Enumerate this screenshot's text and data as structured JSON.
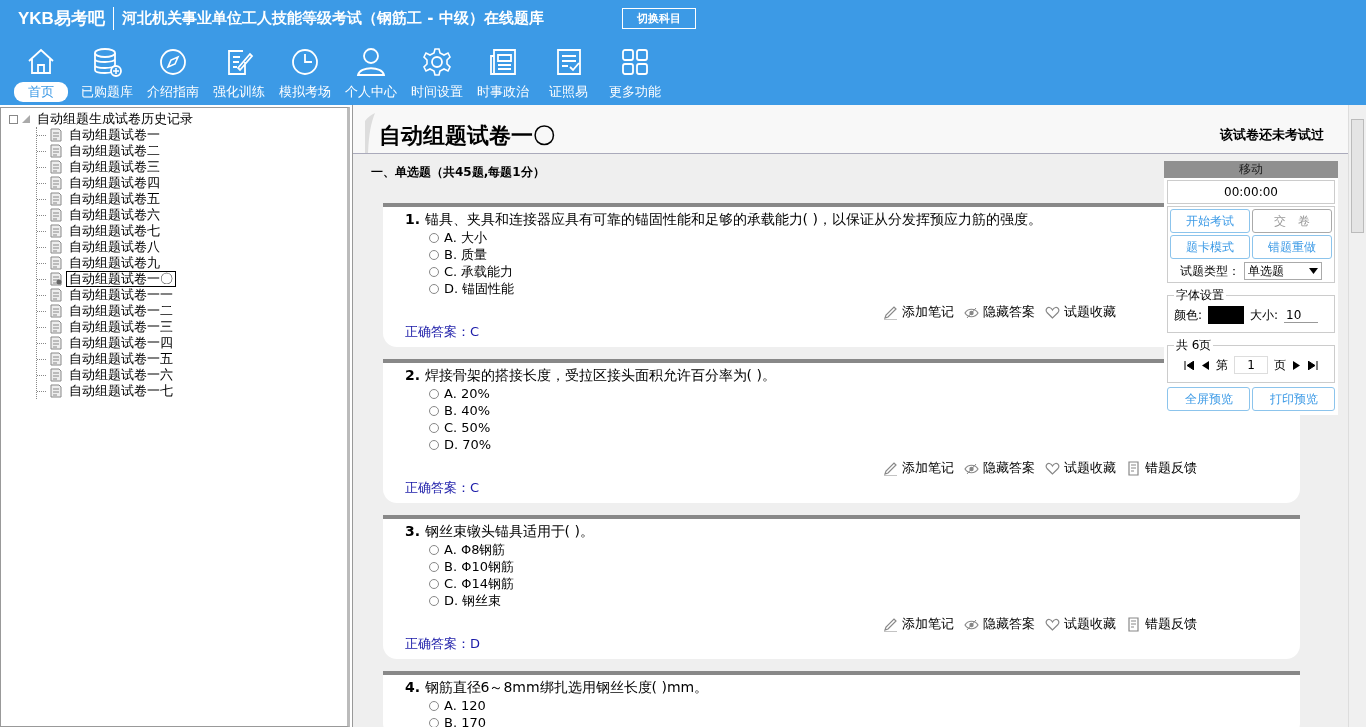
{
  "header": {
    "logo": "YKB易考吧",
    "title": "河北机关事业单位工人技能等级考试（钢筋工 - 中级）在线题库",
    "switch_button": "切换科目"
  },
  "nav": [
    {
      "label": "首页",
      "selected": true
    },
    {
      "label": "已购题库",
      "selected": false
    },
    {
      "label": "介绍指南",
      "selected": false
    },
    {
      "label": "强化训练",
      "selected": false
    },
    {
      "label": "模拟考场",
      "selected": false
    },
    {
      "label": "个人中心",
      "selected": false
    },
    {
      "label": "时间设置",
      "selected": false
    },
    {
      "label": "时事政治",
      "selected": false
    },
    {
      "label": "证照易",
      "selected": false
    },
    {
      "label": "更多功能",
      "selected": false
    }
  ],
  "tree": {
    "label": "自动组题生成试卷历史记录",
    "expanded": true,
    "children": [
      {
        "label": "自动组题试卷一",
        "selected": false
      },
      {
        "label": "自动组题试卷二",
        "selected": false
      },
      {
        "label": "自动组题试卷三",
        "selected": false
      },
      {
        "label": "自动组题试卷四",
        "selected": false
      },
      {
        "label": "自动组题试卷五",
        "selected": false
      },
      {
        "label": "自动组题试卷六",
        "selected": false
      },
      {
        "label": "自动组题试卷七",
        "selected": false
      },
      {
        "label": "自动组题试卷八",
        "selected": false
      },
      {
        "label": "自动组题试卷九",
        "selected": false
      },
      {
        "label": "自动组题试卷一〇",
        "selected": true
      },
      {
        "label": "自动组题试卷一一",
        "selected": false
      },
      {
        "label": "自动组题试卷一二",
        "selected": false
      },
      {
        "label": "自动组题试卷一三",
        "selected": false
      },
      {
        "label": "自动组题试卷一四",
        "selected": false
      },
      {
        "label": "自动组题试卷一五",
        "selected": false
      },
      {
        "label": "自动组题试卷一六",
        "selected": false
      },
      {
        "label": "自动组题试卷一七",
        "selected": false
      }
    ]
  },
  "paper": {
    "title": "自动组题试卷一〇",
    "status": "该试卷还未考试过",
    "section": "一、单选题（共45题,每题1分）"
  },
  "questions": [
    {
      "number": "1.",
      "text": "锚具、夹具和连接器应具有可靠的锚固性能和足够的承载能力( )，以保证从分发挥预应力筋的强度。",
      "options": [
        {
          "label": "A. 大小",
          "selected": false
        },
        {
          "label": "B. 质量",
          "selected": false
        },
        {
          "label": "C. 承载能力",
          "selected": false
        },
        {
          "label": "D. 锚固性能",
          "selected": false
        }
      ],
      "actions": [
        "添加笔记",
        "隐藏答案",
        "试题收藏"
      ],
      "answer": "正确答案：C"
    },
    {
      "number": "2.",
      "text": "焊接骨架的搭接长度，受拉区接头面积允许百分率为( )。",
      "options": [
        {
          "label": "A. 20%",
          "selected": false
        },
        {
          "label": "B. 40%",
          "selected": false
        },
        {
          "label": "C. 50%",
          "selected": false
        },
        {
          "label": "D. 70%",
          "selected": false
        }
      ],
      "actions": [
        "添加笔记",
        "隐藏答案",
        "试题收藏",
        "错题反馈"
      ],
      "answer": "正确答案：C"
    },
    {
      "number": "3.",
      "text": "钢丝束镦头锚具适用于( )。",
      "options": [
        {
          "label": "A. Φ8钢筋",
          "selected": false
        },
        {
          "label": "B. Φ10钢筋",
          "selected": false
        },
        {
          "label": "C. Φ14钢筋",
          "selected": false
        },
        {
          "label": "D. 钢丝束",
          "selected": false
        }
      ],
      "actions": [
        "添加笔记",
        "隐藏答案",
        "试题收藏",
        "错题反馈"
      ],
      "answer": "正确答案：D"
    },
    {
      "number": "4.",
      "text": "钢筋直径6～8mm绑扎选用钢丝长度( )mm。",
      "options": [
        {
          "label": "A. 120",
          "selected": false
        },
        {
          "label": "B. 170",
          "selected": false
        }
      ]
    }
  ],
  "panel": {
    "header": "移动",
    "timer": "00:00:00",
    "buttons": [
      {
        "label": "开始考试",
        "disabled": false
      },
      {
        "label": "交　卷",
        "disabled": true
      },
      {
        "label": "题卡模式",
        "disabled": false
      },
      {
        "label": "错题重做",
        "disabled": false
      }
    ],
    "type_label": "试题类型：",
    "type_value": "单选题",
    "font_group": "字体设置",
    "color_label": "颜色:",
    "color": "#000000",
    "size_label": "大小:",
    "size_value": "10",
    "page_group": "共 6页",
    "page_prefix": "第",
    "page_value": "1",
    "page_suffix": "页",
    "bottom_buttons": [
      "全屏预览",
      "打印预览"
    ]
  }
}
